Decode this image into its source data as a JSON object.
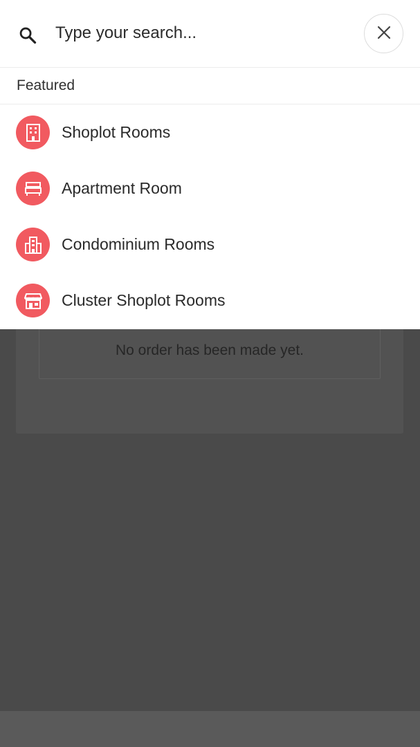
{
  "search": {
    "placeholder": "Type your search...",
    "value": ""
  },
  "featured": {
    "title": "Featured",
    "items": [
      {
        "label": "Shoplot Rooms",
        "icon": "building-icon"
      },
      {
        "label": "Apartment Room",
        "icon": "bed-icon"
      },
      {
        "label": "Condominium Rooms",
        "icon": "city-buildings-icon"
      },
      {
        "label": "Cluster Shoplot Rooms",
        "icon": "storefront-icon"
      }
    ]
  },
  "background": {
    "empty_message": "No order has been made yet."
  },
  "colors": {
    "accent": "#f15a60",
    "overlay_dim": "#4a4a4a"
  }
}
